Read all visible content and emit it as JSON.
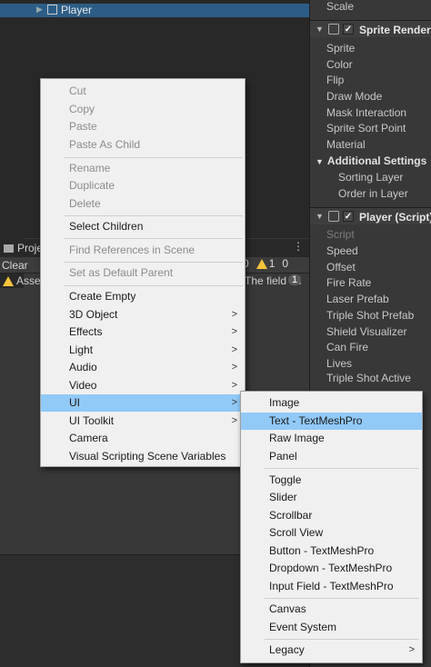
{
  "hierarchy": {
    "selected_label": "Player"
  },
  "project": {
    "tab_label": "Proje",
    "clear_label": "Clear",
    "counter_info": "0",
    "counter_warn": "1",
    "counter_err": "0",
    "console_asset": "Asset",
    "console_field": "The field 'Pl",
    "console_badge": "1"
  },
  "inspector": {
    "scale_label": "Scale",
    "sprite_renderer_header": "Sprite Renderer",
    "sprite_renderer_props": [
      "Sprite",
      "Color",
      "Flip",
      "Draw Mode",
      "Mask Interaction",
      "Sprite Sort Point",
      "Material"
    ],
    "additional_settings": "Additional Settings",
    "additional_props": [
      "Sorting Layer",
      "Order in Layer"
    ],
    "player_script_header": "Player (Script)",
    "script_label": "Script",
    "player_props": [
      "Speed",
      "Offset",
      "Fire Rate",
      "Laser Prefab",
      "Triple Shot Prefab",
      "Shield Visualizer",
      "Can Fire",
      "Lives",
      "Triple Shot Active"
    ]
  },
  "context_menu": {
    "items": [
      {
        "label": "Cut",
        "disabled": true
      },
      {
        "label": "Copy",
        "disabled": true
      },
      {
        "label": "Paste",
        "disabled": true
      },
      {
        "label": "Paste As Child",
        "disabled": true
      },
      {
        "label": "Rename",
        "disabled": true
      },
      {
        "label": "Duplicate",
        "disabled": true
      },
      {
        "label": "Delete",
        "disabled": true
      },
      {
        "label": "Select Children",
        "disabled": false
      },
      {
        "label": "Find References in Scene",
        "disabled": true
      },
      {
        "label": "Set as Default Parent",
        "disabled": true
      },
      {
        "label": "Create Empty",
        "disabled": false
      },
      {
        "label": "3D Object",
        "disabled": false,
        "submenu": true
      },
      {
        "label": "Effects",
        "disabled": false,
        "submenu": true
      },
      {
        "label": "Light",
        "disabled": false,
        "submenu": true
      },
      {
        "label": "Audio",
        "disabled": false,
        "submenu": true
      },
      {
        "label": "Video",
        "disabled": false,
        "submenu": true
      },
      {
        "label": "UI",
        "disabled": false,
        "submenu": true,
        "highlighted": true
      },
      {
        "label": "UI Toolkit",
        "disabled": false,
        "submenu": true
      },
      {
        "label": "Camera",
        "disabled": false
      },
      {
        "label": "Visual Scripting Scene Variables",
        "disabled": false
      }
    ]
  },
  "ui_submenu": {
    "items": [
      {
        "label": "Image"
      },
      {
        "label": "Text - TextMeshPro",
        "highlighted": true
      },
      {
        "label": "Raw Image"
      },
      {
        "label": "Panel"
      },
      {
        "label": "Toggle"
      },
      {
        "label": "Slider"
      },
      {
        "label": "Scrollbar"
      },
      {
        "label": "Scroll View"
      },
      {
        "label": "Button - TextMeshPro"
      },
      {
        "label": "Dropdown - TextMeshPro"
      },
      {
        "label": "Input Field - TextMeshPro"
      },
      {
        "label": "Canvas"
      },
      {
        "label": "Event System"
      },
      {
        "label": "Legacy",
        "submenu": true
      }
    ]
  },
  "colors": {
    "highlight": "#91c9f7",
    "selection": "#2c5d87",
    "warning": "#f5c33b"
  }
}
